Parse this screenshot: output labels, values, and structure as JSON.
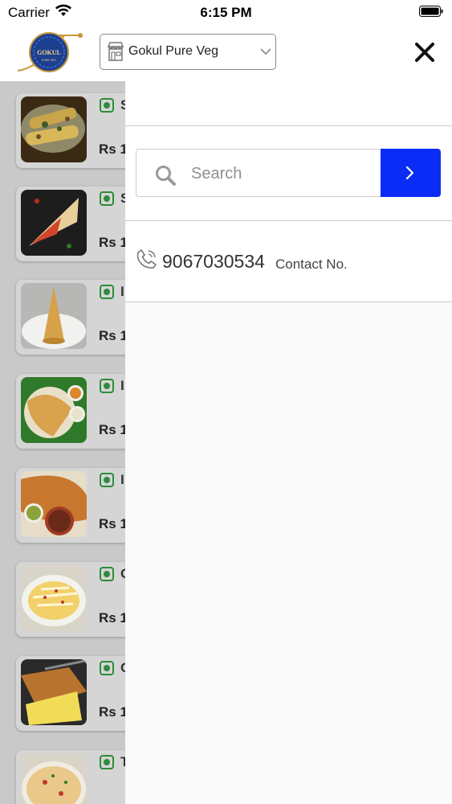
{
  "status_bar": {
    "carrier": "Carrier",
    "time": "6:15 PM"
  },
  "header": {
    "logo_text": "GOKUL",
    "logo_subtext": "PURE VEG",
    "store_name": "Gokul Pure Veg",
    "close_icon": "close-icon"
  },
  "menu_items": [
    {
      "initial": "S",
      "price": "Rs 1"
    },
    {
      "initial": "S",
      "price": "Rs 1"
    },
    {
      "initial": "I",
      "price": "Rs 1"
    },
    {
      "initial": "I",
      "price": "Rs 1"
    },
    {
      "initial": "I",
      "price": "Rs 1"
    },
    {
      "initial": "C",
      "price": "Rs 1"
    },
    {
      "initial": "C",
      "price": "Rs 1"
    },
    {
      "initial": "T",
      "price": ""
    }
  ],
  "drawer": {
    "search": {
      "placeholder": "Search",
      "value": ""
    },
    "contact": {
      "number": "9067030534",
      "label": "Contact No."
    }
  },
  "colors": {
    "accent": "#0a2cf6",
    "veg_green": "#2e8b3a"
  }
}
